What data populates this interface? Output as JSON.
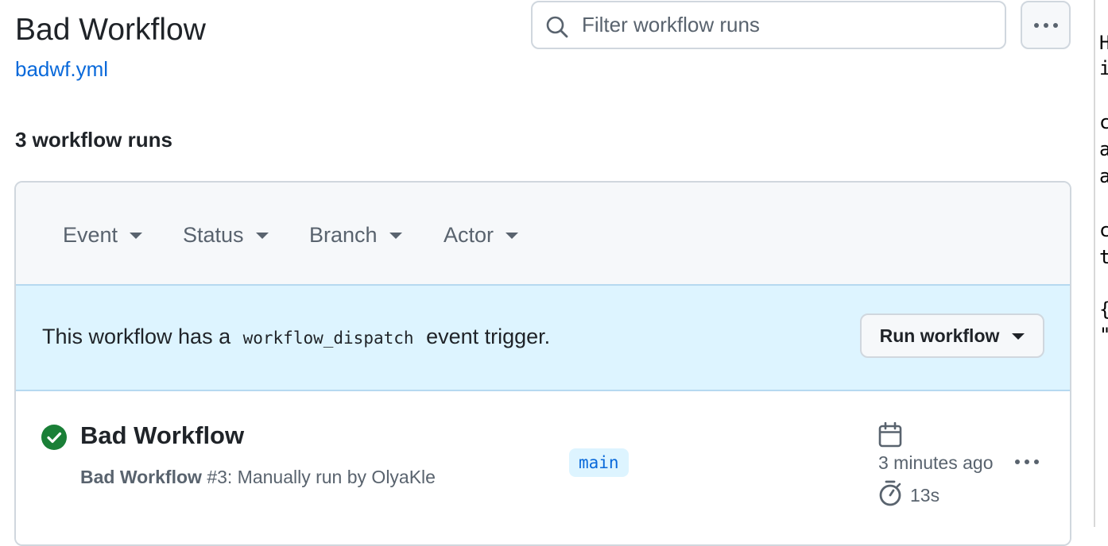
{
  "header": {
    "title": "Bad Workflow",
    "file_link": "badwf.yml",
    "search_placeholder": "Filter workflow runs",
    "runs_count": "3 workflow runs"
  },
  "filters": [
    {
      "label": "Event"
    },
    {
      "label": "Status"
    },
    {
      "label": "Branch"
    },
    {
      "label": "Actor"
    }
  ],
  "dispatch": {
    "text_before": "This workflow has a",
    "code": "workflow_dispatch",
    "text_after": "event trigger.",
    "run_button": "Run workflow"
  },
  "runs": [
    {
      "status": "success",
      "title": "Bad Workflow",
      "workflow_name": "Bad Workflow",
      "detail": "#3: Manually run by OlyaKle",
      "branch": "main",
      "time_ago": "3 minutes ago",
      "duration": "13s"
    }
  ],
  "colors": {
    "success": "#1a7f37",
    "link": "#0969da",
    "banner": "#ddf4ff"
  }
}
